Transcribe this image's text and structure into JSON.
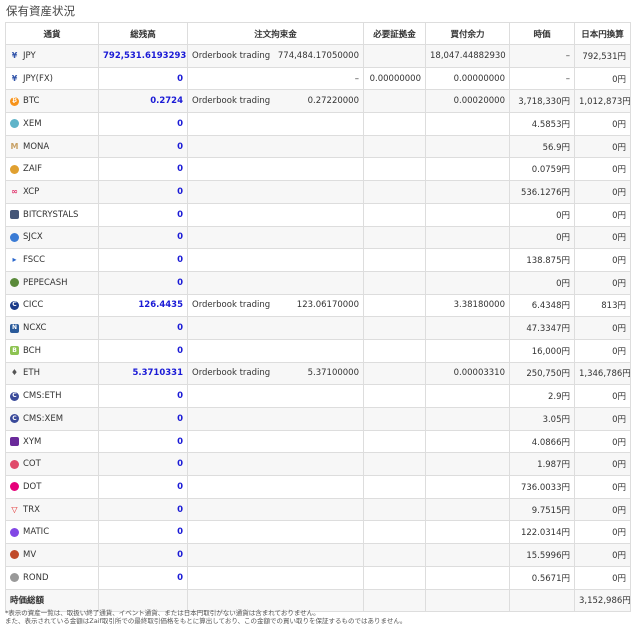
{
  "page": {
    "title": "保有資産状況"
  },
  "table": {
    "headers": {
      "currency": "通貨",
      "balance": "総残高",
      "order_reserved": "注文拘束金",
      "margin": "必要証拠金",
      "buying_power": "買付余力",
      "price": "時価",
      "jpy_value": "日本円換算"
    },
    "rows": [
      {
        "currency": "JPY",
        "icon": "yen-icon",
        "balance": "792,531.6193293",
        "order_type": "Orderbook trading",
        "order_amount": "774,484.17050000",
        "margin": "",
        "buying_power": "18,047.44882930",
        "price": "–",
        "jpy_value": "792,531円"
      },
      {
        "currency": "JPY(FX)",
        "icon": "yen-icon",
        "balance": "0",
        "order_type": "",
        "order_amount": "–",
        "margin": "0.00000000",
        "buying_power": "0.00000000",
        "price": "–",
        "jpy_value": "0円"
      },
      {
        "currency": "BTC",
        "icon": "btc-icon",
        "balance": "0.2724",
        "order_type": "Orderbook trading",
        "order_amount": "0.27220000",
        "margin": "",
        "buying_power": "0.00020000",
        "price": "3,718,330円",
        "jpy_value": "1,012,873円"
      },
      {
        "currency": "XEM",
        "icon": "xem-icon",
        "balance": "0",
        "order_type": "",
        "order_amount": "",
        "margin": "",
        "buying_power": "",
        "price": "4.5853円",
        "jpy_value": "0円"
      },
      {
        "currency": "MONA",
        "icon": "mona-icon",
        "balance": "0",
        "order_type": "",
        "order_amount": "",
        "margin": "",
        "buying_power": "",
        "price": "56.9円",
        "jpy_value": "0円"
      },
      {
        "currency": "ZAIF",
        "icon": "zaif-icon",
        "balance": "0",
        "order_type": "",
        "order_amount": "",
        "margin": "",
        "buying_power": "",
        "price": "0.0759円",
        "jpy_value": "0円"
      },
      {
        "currency": "XCP",
        "icon": "xcp-icon",
        "balance": "0",
        "order_type": "",
        "order_amount": "",
        "margin": "",
        "buying_power": "",
        "price": "536.1276円",
        "jpy_value": "0円"
      },
      {
        "currency": "BITCRYSTALS",
        "icon": "bitcrystals-icon",
        "balance": "0",
        "order_type": "",
        "order_amount": "",
        "margin": "",
        "buying_power": "",
        "price": "0円",
        "jpy_value": "0円"
      },
      {
        "currency": "SJCX",
        "icon": "sjcx-icon",
        "balance": "0",
        "order_type": "",
        "order_amount": "",
        "margin": "",
        "buying_power": "",
        "price": "0円",
        "jpy_value": "0円"
      },
      {
        "currency": "FSCC",
        "icon": "fscc-icon",
        "balance": "0",
        "order_type": "",
        "order_amount": "",
        "margin": "",
        "buying_power": "",
        "price": "138.875円",
        "jpy_value": "0円"
      },
      {
        "currency": "PEPECASH",
        "icon": "pepecash-icon",
        "balance": "0",
        "order_type": "",
        "order_amount": "",
        "margin": "",
        "buying_power": "",
        "price": "0円",
        "jpy_value": "0円"
      },
      {
        "currency": "CICC",
        "icon": "cicc-icon",
        "balance": "126.4435",
        "order_type": "Orderbook trading",
        "order_amount": "123.06170000",
        "margin": "",
        "buying_power": "3.38180000",
        "price": "6.4348円",
        "jpy_value": "813円"
      },
      {
        "currency": "NCXC",
        "icon": "ncxc-icon",
        "balance": "0",
        "order_type": "",
        "order_amount": "",
        "margin": "",
        "buying_power": "",
        "price": "47.3347円",
        "jpy_value": "0円"
      },
      {
        "currency": "BCH",
        "icon": "bch-icon",
        "balance": "0",
        "order_type": "",
        "order_amount": "",
        "margin": "",
        "buying_power": "",
        "price": "16,000円",
        "jpy_value": "0円"
      },
      {
        "currency": "ETH",
        "icon": "eth-icon",
        "balance": "5.3710331",
        "order_type": "Orderbook trading",
        "order_amount": "5.37100000",
        "margin": "",
        "buying_power": "0.00003310",
        "price": "250,750円",
        "jpy_value": "1,346,786円"
      },
      {
        "currency": "CMS:ETH",
        "icon": "cms-icon",
        "balance": "0",
        "order_type": "",
        "order_amount": "",
        "margin": "",
        "buying_power": "",
        "price": "2.9円",
        "jpy_value": "0円"
      },
      {
        "currency": "CMS:XEM",
        "icon": "cms-icon",
        "balance": "0",
        "order_type": "",
        "order_amount": "",
        "margin": "",
        "buying_power": "",
        "price": "3.05円",
        "jpy_value": "0円"
      },
      {
        "currency": "XYM",
        "icon": "xym-icon",
        "balance": "0",
        "order_type": "",
        "order_amount": "",
        "margin": "",
        "buying_power": "",
        "price": "4.0866円",
        "jpy_value": "0円"
      },
      {
        "currency": "COT",
        "icon": "cot-icon",
        "balance": "0",
        "order_type": "",
        "order_amount": "",
        "margin": "",
        "buying_power": "",
        "price": "1.987円",
        "jpy_value": "0円"
      },
      {
        "currency": "DOT",
        "icon": "dot-icon",
        "balance": "0",
        "order_type": "",
        "order_amount": "",
        "margin": "",
        "buying_power": "",
        "price": "736.0033円",
        "jpy_value": "0円"
      },
      {
        "currency": "TRX",
        "icon": "trx-icon",
        "balance": "0",
        "order_type": "",
        "order_amount": "",
        "margin": "",
        "buying_power": "",
        "price": "9.7515円",
        "jpy_value": "0円"
      },
      {
        "currency": "MATIC",
        "icon": "matic-icon",
        "balance": "0",
        "order_type": "",
        "order_amount": "",
        "margin": "",
        "buying_power": "",
        "price": "122.0314円",
        "jpy_value": "0円"
      },
      {
        "currency": "MV",
        "icon": "mv-icon",
        "balance": "0",
        "order_type": "",
        "order_amount": "",
        "margin": "",
        "buying_power": "",
        "price": "15.5996円",
        "jpy_value": "0円"
      },
      {
        "currency": "ROND",
        "icon": "rond-icon",
        "balance": "0",
        "order_type": "",
        "order_amount": "",
        "margin": "",
        "buying_power": "",
        "price": "0.5671円",
        "jpy_value": "0円"
      }
    ],
    "footer": {
      "label": "時価総額",
      "total": "3,152,986円"
    }
  },
  "notes": [
    "*表示の資産一覧は、取扱い終了通貨、イベント通貨、または日本円取引がない通貨は含まれておりません。",
    "また、表示されている金額はZaif取引所での最終取引価格をもとに算出しており、この金額での買い取りを保証するものではありません。"
  ],
  "colors": {
    "balance_text": "#1a1ad6",
    "row_stripe": "#f7f7f7",
    "border": "#dddddd"
  }
}
